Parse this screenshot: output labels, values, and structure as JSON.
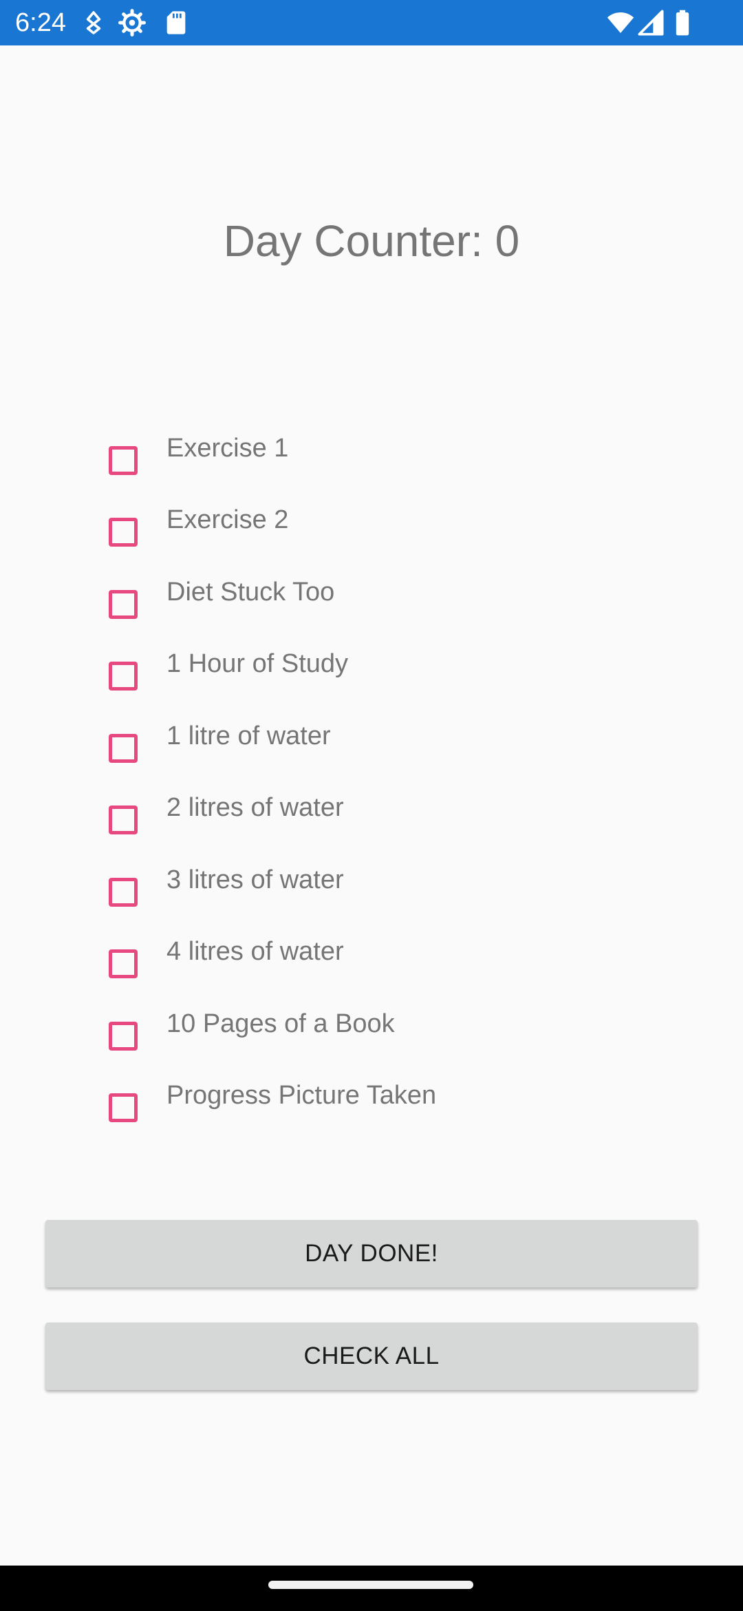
{
  "status_bar": {
    "time": "6:24",
    "background": "#1976d2",
    "icons": [
      "download-indicator-icon",
      "settings-gear-icon",
      "sd-card-icon",
      "wifi-icon",
      "cell-signal-icon",
      "battery-icon"
    ]
  },
  "title": "Day Counter: 0",
  "checklist": {
    "accent_color": "#e6487f",
    "items": [
      {
        "label": "Exercise 1",
        "checked": false
      },
      {
        "label": "Exercise 2",
        "checked": false
      },
      {
        "label": "Diet Stuck Too",
        "checked": false
      },
      {
        "label": "1 Hour of Study",
        "checked": false
      },
      {
        "label": "1 litre of water",
        "checked": false
      },
      {
        "label": "2 litres of water",
        "checked": false
      },
      {
        "label": "3 litres of water",
        "checked": false
      },
      {
        "label": "4 litres of water",
        "checked": false
      },
      {
        "label": "10 Pages of a Book",
        "checked": false
      },
      {
        "label": "Progress Picture Taken",
        "checked": false
      }
    ]
  },
  "buttons": {
    "day_done": "DAY DONE!",
    "check_all": "CHECK ALL"
  }
}
